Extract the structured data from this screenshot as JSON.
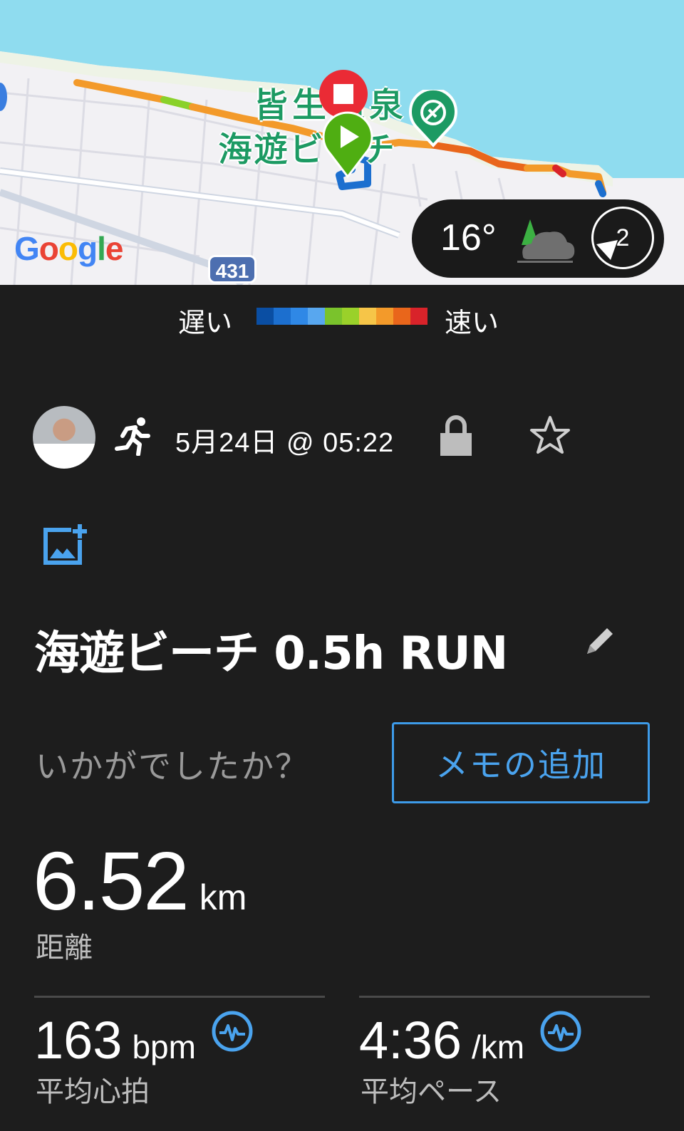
{
  "map": {
    "logo": {
      "g1": "G",
      "o1": "o",
      "o2": "o",
      "g2": "g",
      "l": "l",
      "e": "e"
    },
    "road_sign": "431",
    "place_label_line1": "皆生温泉",
    "place_label_line2": "海遊ビーチ",
    "weather": {
      "temperature": "16°",
      "wind_level": "2"
    }
  },
  "legend": {
    "slow_label": "遅い",
    "fast_label": "速い",
    "colors": [
      "#0a4ea3",
      "#1c6fcf",
      "#2f88e6",
      "#58a7ef",
      "#7ac32c",
      "#9ad12a",
      "#f6c548",
      "#f39a2a",
      "#e9661b",
      "#d9232a"
    ]
  },
  "activity": {
    "datetime": "5月24日 @ 05:22",
    "title": "海遊ビーチ 0.5h RUN",
    "question": "いかがでしたか？",
    "memo_button": "メモの追加"
  },
  "stats": {
    "distance": {
      "value": "6.52",
      "unit": "km",
      "label": "距離"
    },
    "heart_rate": {
      "value": "163",
      "unit": "bpm",
      "label": "平均心拍"
    },
    "pace": {
      "value": "4:36",
      "unit": "/km",
      "label": "平均ペース"
    }
  },
  "colors": {
    "accent": "#4aa3ee",
    "background": "#1d1d1d",
    "sea": "#8fdcef"
  }
}
